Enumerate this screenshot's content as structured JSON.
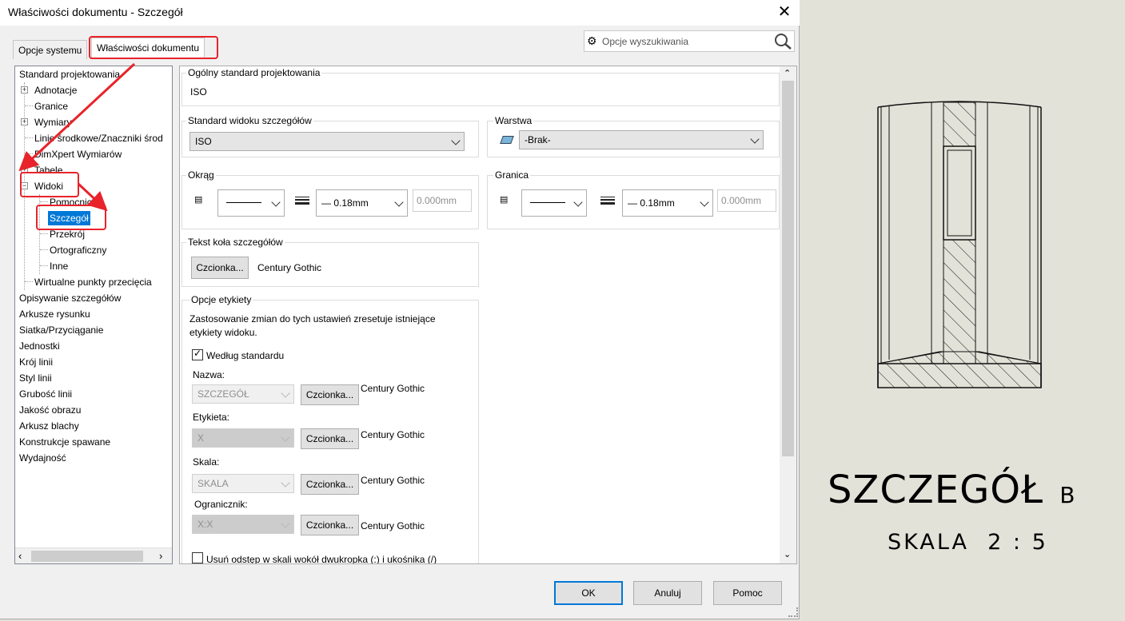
{
  "window": {
    "title": "Właściwości dokumentu - Szczegół",
    "close": "✕"
  },
  "tabs": [
    {
      "label": "Opcje systemu"
    },
    {
      "label": "Właściwości dokumentu"
    }
  ],
  "search": {
    "placeholder": "Opcje wyszukiwania"
  },
  "tree": {
    "items": [
      "Standard projektowania",
      "Adnotacje",
      "Granice",
      "Wymiary",
      "Linie środkowe/Znaczniki środ",
      "DimXpert Wymiarów",
      "Tabele",
      "Widoki",
      "Pomocniczy",
      "Szczegół",
      "Przekrój",
      "Ortograficzny",
      "Inne",
      "Wirtualne punkty przecięcia",
      "Opisywanie szczegółów",
      "Arkusze rysunku",
      "Siatka/Przyciąganie",
      "Jednostki",
      "Krój linii",
      "Styl linii",
      "Grubość linii",
      "Jakość obrazu",
      "Arkusz blachy",
      "Konstrukcje spawane",
      "Wydajność"
    ],
    "selected": "Szczegół"
  },
  "panel": {
    "design_standard": {
      "label": "Ogólny standard projektowania",
      "value": "ISO"
    },
    "detail_standard": {
      "label": "Standard widoku szczegółów",
      "value": "ISO"
    },
    "layer": {
      "label": "Warstwa",
      "value": "-Brak-"
    },
    "circle": {
      "label": "Okrąg",
      "thickness": "0.18mm",
      "custom": "0.000mm"
    },
    "border": {
      "label": "Granica",
      "thickness": "0.18mm",
      "custom": "0.000mm"
    },
    "detail_circle_text": {
      "label": "Tekst koła szczegółów",
      "font_button": "Czcionka...",
      "font": "Century Gothic"
    },
    "label_options": {
      "label": "Opcje etykiety",
      "note_line1": "Zastosowanie zmian do tych ustawień zresetuje istniejące",
      "note_line2": "etykiety widoku.",
      "by_standard": "Według standardu",
      "fields": [
        {
          "label": "Nazwa:",
          "value": "SZCZEGÓŁ",
          "button": "Czcionka...",
          "font": "Century Gothic"
        },
        {
          "label": "Etykieta:",
          "value": "X",
          "button": "Czcionka...",
          "font": "Century Gothic"
        },
        {
          "label": "Skala:",
          "value": "SKALA",
          "button": "Czcionka...",
          "font": "Century Gothic"
        },
        {
          "label": "Ogranicznik:",
          "value": "X:X",
          "button": "Czcionka...",
          "font": "Century Gothic"
        }
      ],
      "remove_spacing": "Usuń odstęp w skali wokół dwukropka (:) i ukośnika (/)"
    }
  },
  "buttons": {
    "ok": "OK",
    "cancel": "Anuluj",
    "help": "Pomoc"
  },
  "drawing": {
    "title": "SZCZEGÓŁ",
    "letter": "B",
    "scale": "SKALA  2 : 5"
  },
  "colors": {
    "selection": "#0078d7",
    "annotation_red": "#e8232b",
    "background": "#e3e2d9"
  }
}
